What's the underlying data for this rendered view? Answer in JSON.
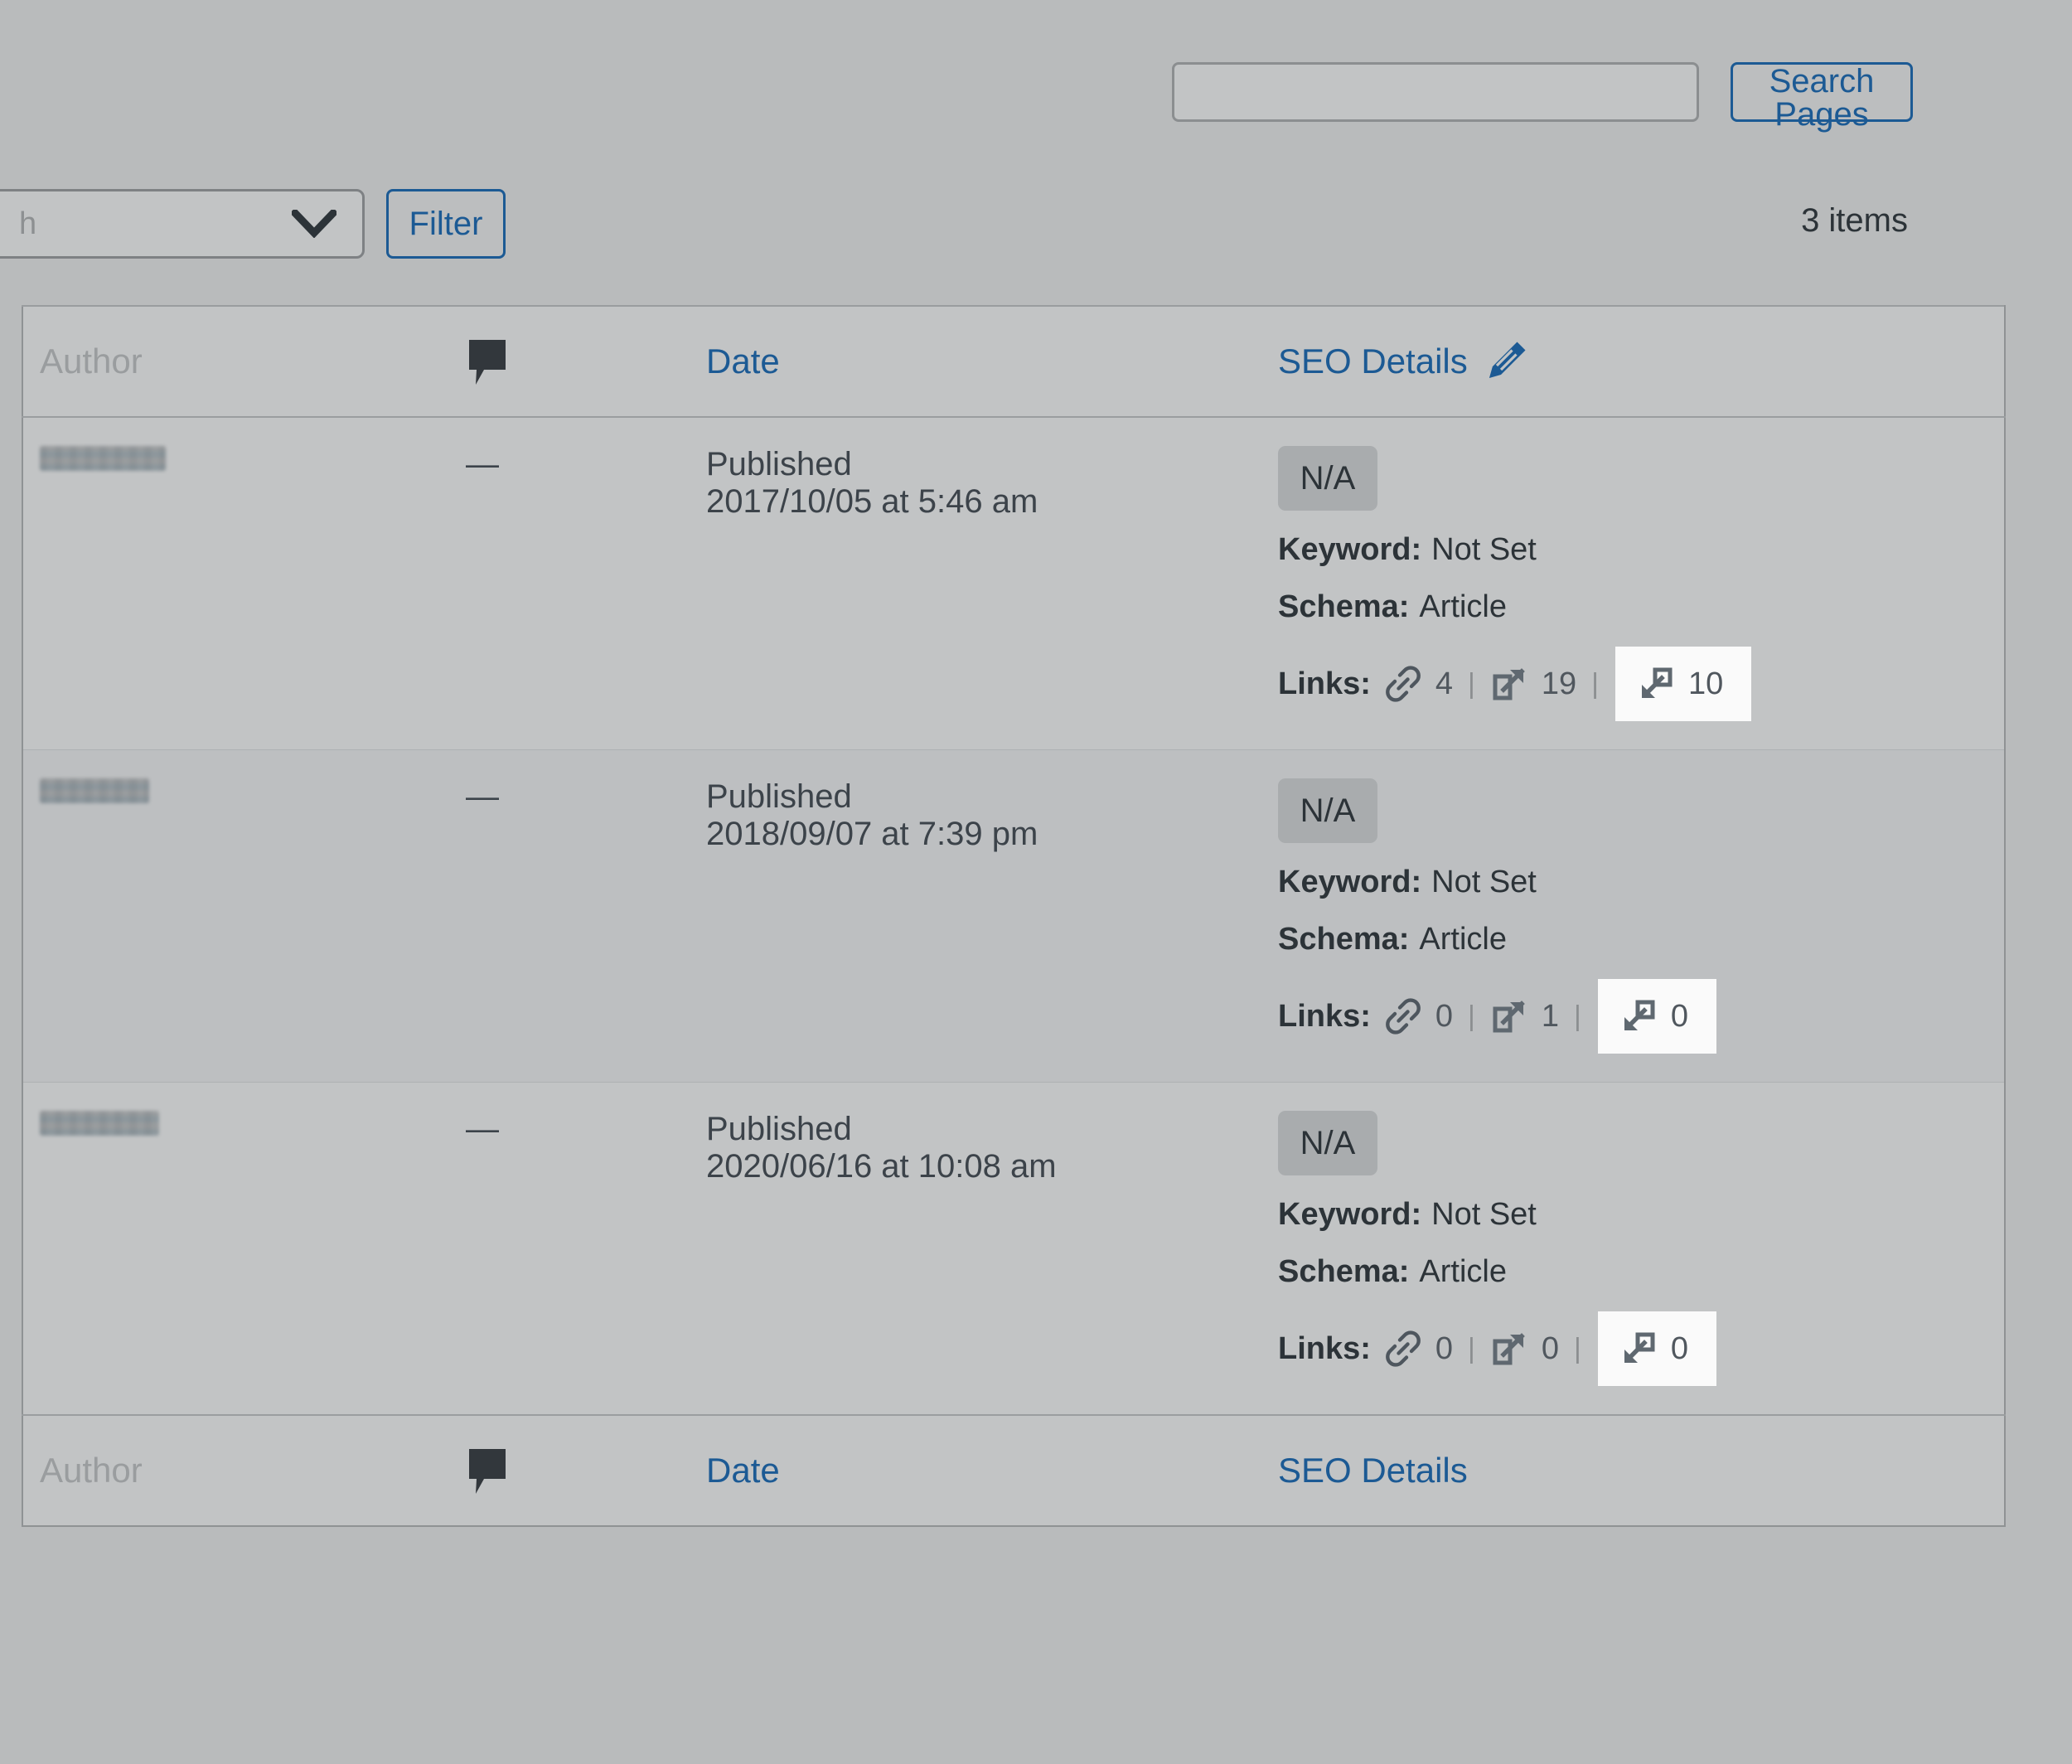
{
  "search": {
    "value": "",
    "placeholder": "",
    "button_label": "Search Pages"
  },
  "filters": {
    "select_value": "h",
    "filter_button_label": "Filter",
    "item_count": "3 items"
  },
  "table": {
    "columns": {
      "author": "Author",
      "comments_icon": "comment-bubble-icon",
      "date": "Date",
      "seo_details": "SEO Details",
      "seo_details_edit_icon": "pencil-edit-icon"
    },
    "rows": [
      {
        "author": "",
        "comments": "—",
        "date_status": "Published",
        "date_value": "2017/10/05 at 5:46 am",
        "seo": {
          "score_badge": "N/A",
          "keyword_label": "Keyword:",
          "keyword_value": "Not Set",
          "schema_label": "Schema:",
          "schema_value": "Article",
          "links_label": "Links:",
          "internal_links": "4",
          "external_links": "19",
          "inbound_links": "10"
        }
      },
      {
        "author": "",
        "comments": "—",
        "date_status": "Published",
        "date_value": "2018/09/07 at 7:39 pm",
        "seo": {
          "score_badge": "N/A",
          "keyword_label": "Keyword:",
          "keyword_value": "Not Set",
          "schema_label": "Schema:",
          "schema_value": "Article",
          "links_label": "Links:",
          "internal_links": "0",
          "external_links": "1",
          "inbound_links": "0"
        }
      },
      {
        "author": "",
        "comments": "—",
        "date_status": "Published",
        "date_value": "2020/06/16 at 10:08 am",
        "seo": {
          "score_badge": "N/A",
          "keyword_label": "Keyword:",
          "keyword_value": "Not Set",
          "schema_label": "Schema:",
          "schema_value": "Article",
          "links_label": "Links:",
          "internal_links": "0",
          "external_links": "0",
          "inbound_links": "0"
        }
      }
    ],
    "footer_columns": {
      "author": "Author",
      "comments_icon": "comment-bubble-icon",
      "date": "Date",
      "seo_details": "SEO Details"
    }
  },
  "colors": {
    "page_background": "#b9bbbc",
    "table_background": "#c2c4c5",
    "row_alt_background": "#bdbfc1",
    "link_blue": "#1c5a94",
    "text_dark": "#2c3338",
    "muted": "#8b8e90",
    "badge_gray": "#a9acae",
    "highlight_white": "#fafafa",
    "icon_gray": "#5f6870"
  },
  "icons": {
    "chain_link": "chain-link-icon",
    "external_link": "external-link-icon",
    "inbound_link": "inbound-link-icon",
    "chevron_down": "chevron-down-icon"
  }
}
